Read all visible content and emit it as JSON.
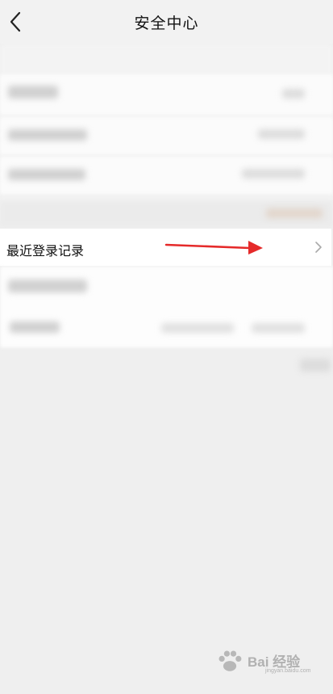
{
  "header": {
    "title": "安全中心",
    "back_icon": "chevron-left-icon"
  },
  "main": {
    "highlighted_item": {
      "label": "最近登录记录",
      "icon": "chevron-right-icon"
    }
  },
  "annotation": {
    "arrow_color": "#e52a2a"
  },
  "watermark": {
    "text": "Bai 经验",
    "sub": "jingyan.baidu.com"
  }
}
